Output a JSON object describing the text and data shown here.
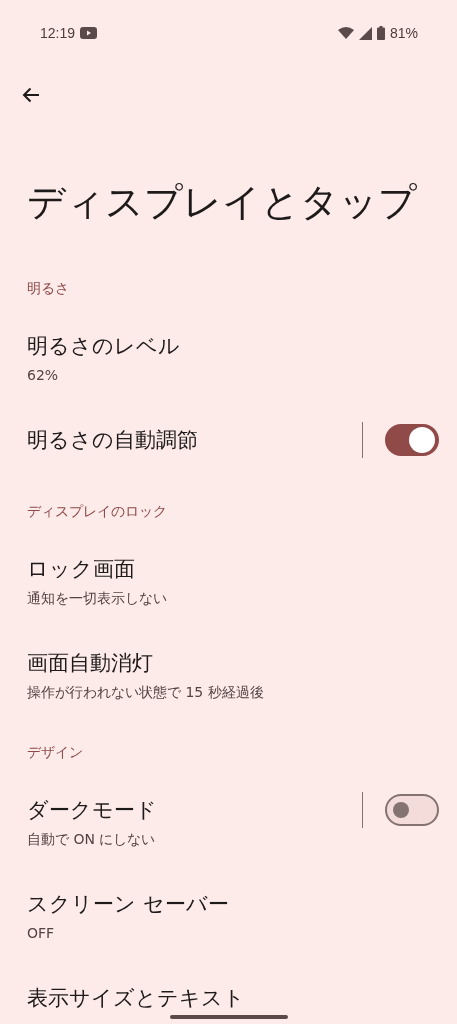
{
  "status_bar": {
    "time": "12:19",
    "battery": "81%"
  },
  "title": "ディスプレイとタップ",
  "sections": [
    {
      "header": "明るさ",
      "items": [
        {
          "kind": "text",
          "title": "明るさのレベル",
          "subtitle": "62%"
        },
        {
          "kind": "switch",
          "title": "明るさの自動調節",
          "on": true
        }
      ]
    },
    {
      "header": "ディスプレイのロック",
      "items": [
        {
          "kind": "text",
          "title": "ロック画面",
          "subtitle": "通知を一切表示しない"
        },
        {
          "kind": "text",
          "title": "画面自動消灯",
          "subtitle": "操作が行われない状態で 15 秒経過後"
        }
      ]
    },
    {
      "header": "デザイン",
      "items": [
        {
          "kind": "switch",
          "title": "ダークモード",
          "subtitle": "自動で ON にしない",
          "on": false
        },
        {
          "kind": "text",
          "title": "スクリーン セーバー",
          "subtitle": "OFF"
        },
        {
          "kind": "text",
          "title": "表示サイズとテキスト"
        }
      ]
    }
  ]
}
